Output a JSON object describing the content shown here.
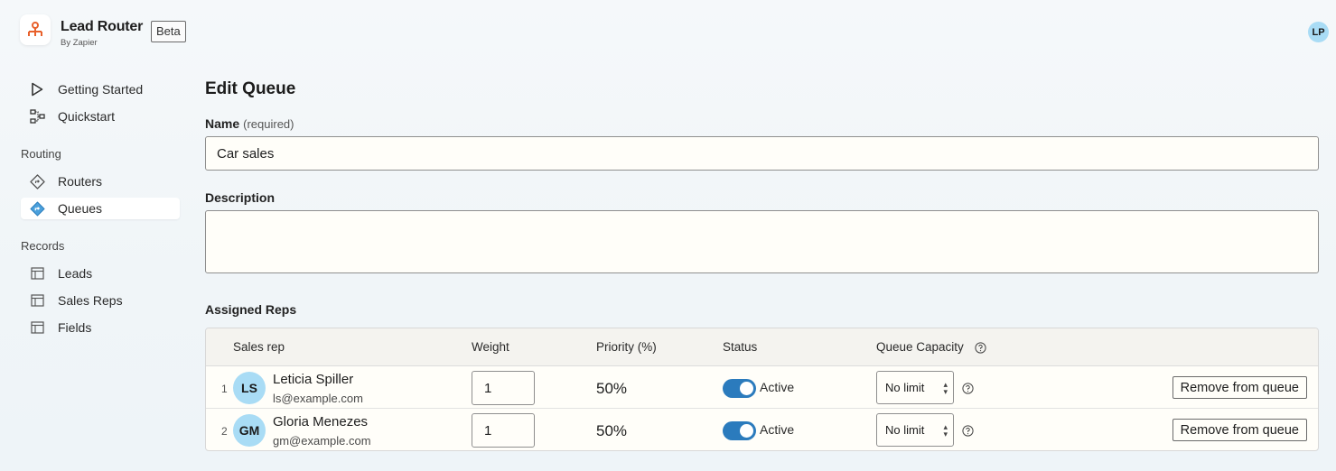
{
  "app": {
    "title": "Lead Router",
    "subtitle": "By Zapier",
    "badge": "Beta",
    "user_initials": "LP",
    "accent_color": "#e8612c"
  },
  "sidebar": {
    "items_top": [
      {
        "label": "Getting Started",
        "icon": "play-icon"
      },
      {
        "label": "Quickstart",
        "icon": "flow-icon"
      }
    ],
    "routing_label": "Routing",
    "routing_items": [
      {
        "label": "Routers",
        "icon": "diamond-route-icon"
      },
      {
        "label": "Queues",
        "icon": "queue-icon",
        "active": true
      }
    ],
    "records_label": "Records",
    "records_items": [
      {
        "label": "Leads",
        "icon": "table-icon"
      },
      {
        "label": "Sales Reps",
        "icon": "table-icon"
      },
      {
        "label": "Fields",
        "icon": "table-icon"
      }
    ]
  },
  "main": {
    "title": "Edit Queue",
    "name_label": "Name",
    "name_hint": "(required)",
    "name_value": "Car sales",
    "description_label": "Description",
    "description_value": "",
    "assigned_label": "Assigned Reps",
    "table": {
      "headers": {
        "rep": "Sales rep",
        "weight": "Weight",
        "priority": "Priority (%)",
        "status": "Status",
        "capacity": "Queue Capacity"
      },
      "rows": [
        {
          "num": "1",
          "initials": "LS",
          "name": "Leticia Spiller",
          "email": "ls@example.com",
          "weight": "1",
          "priority": "50%",
          "status": "Active",
          "active": true,
          "capacity": "No limit",
          "remove_label": "Remove from queue"
        },
        {
          "num": "2",
          "initials": "GM",
          "name": "Gloria Menezes",
          "email": "gm@example.com",
          "weight": "1",
          "priority": "50%",
          "status": "Active",
          "active": true,
          "capacity": "No limit",
          "remove_label": "Remove from queue"
        }
      ]
    }
  }
}
